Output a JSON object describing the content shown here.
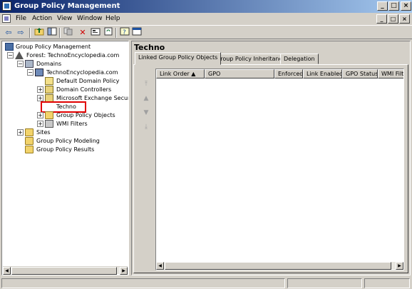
{
  "window": {
    "title": "Group Policy Management"
  },
  "caption_buttons": [
    "_",
    "□",
    "×"
  ],
  "menu": [
    "File",
    "Action",
    "View",
    "Window",
    "Help"
  ],
  "mdi_buttons": [
    "_",
    "□",
    "×"
  ],
  "toolbar": [
    "back-icon",
    "forward-icon",
    "up-folder-icon",
    "show-hide-tree-icon",
    "copy-icon",
    "delete-icon",
    "properties-icon",
    "refresh-icon",
    "help-icon",
    "console-icon"
  ],
  "tree": [
    {
      "label": "Group Policy Management",
      "icon": "gp"
    },
    {
      "label": "Forest: TechnoEncyclopedia.com",
      "icon": "forest",
      "expander": "−"
    },
    {
      "label": "Domains",
      "icon": "domains",
      "expander": "−"
    },
    {
      "label": "TechnoEncyclopedia.com",
      "icon": "domain",
      "expander": "−"
    },
    {
      "label": "Default Domain Policy",
      "icon": "policy"
    },
    {
      "label": "Domain Controllers",
      "icon": "ou",
      "expander": "+"
    },
    {
      "label": "Microsoft Exchange Security",
      "icon": "ou",
      "expander": "+"
    },
    {
      "label": "Techno",
      "icon": "ou",
      "selected": true
    },
    {
      "label": "Group Policy Objects",
      "icon": "folder",
      "expander": "+"
    },
    {
      "label": "WMI Filters",
      "icon": "filter",
      "expander": "+"
    },
    {
      "label": "Sites",
      "icon": "folder",
      "expander": "+"
    },
    {
      "label": "Group Policy Modeling",
      "icon": "folder"
    },
    {
      "label": "Group Policy Results",
      "icon": "folder"
    }
  ],
  "right": {
    "title": "Techno",
    "tabs": [
      "Linked Group Policy Objects",
      "Group Policy Inheritance",
      "Delegation"
    ],
    "arrows": [
      "move-top-icon",
      "move-up-icon",
      "move-down-icon",
      "move-bottom-icon"
    ],
    "columns": [
      "Link Order",
      "GPO",
      "Enforced",
      "Link Enabled",
      "GPO Status",
      "WMI Filt"
    ]
  }
}
